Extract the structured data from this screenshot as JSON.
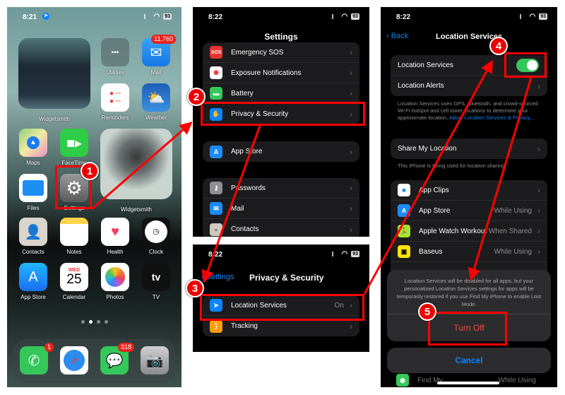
{
  "home": {
    "status": {
      "time": "8:21",
      "battery": "93"
    },
    "widgets": [
      {
        "label": "Widgetsmith"
      },
      {
        "label": "Widgetsmith"
      }
    ],
    "apps": [
      {
        "label": "Utilities"
      },
      {
        "label": "Mail",
        "badge": "11,760"
      },
      {
        "label": "Reminders"
      },
      {
        "label": "Weather"
      },
      {
        "label": "Maps"
      },
      {
        "label": "FaceTime"
      },
      {
        "label": "Files"
      },
      {
        "label": "Settings"
      },
      {
        "label": "Contacts"
      },
      {
        "label": "Notes"
      },
      {
        "label": "Health"
      },
      {
        "label": "Clock"
      },
      {
        "label": "App Store"
      },
      {
        "label": "Calendar",
        "day": "WED",
        "date": "25"
      },
      {
        "label": "Photos"
      },
      {
        "label": "TV"
      }
    ],
    "dock": [
      {
        "name": "Phone",
        "badge": "1"
      },
      {
        "name": "Safari"
      },
      {
        "name": "Messages",
        "badge": "318"
      },
      {
        "name": "Camera"
      }
    ]
  },
  "settings": {
    "status": {
      "time": "8:22",
      "battery": "93"
    },
    "title": "Settings",
    "rows": [
      {
        "label": "Emergency SOS",
        "icon": "SOS"
      },
      {
        "label": "Exposure Notifications"
      },
      {
        "label": "Battery"
      },
      {
        "label": "Privacy & Security"
      },
      {
        "label": "App Store"
      },
      {
        "label": "Passwords"
      },
      {
        "label": "Mail"
      },
      {
        "label": "Contacts"
      }
    ]
  },
  "privacy": {
    "status": {
      "time": "8:22",
      "battery": "93"
    },
    "back": "Settings",
    "title": "Privacy & Security",
    "rows": [
      {
        "label": "Location Services",
        "value": "On"
      },
      {
        "label": "Tracking"
      }
    ]
  },
  "location": {
    "status": {
      "time": "8:22",
      "battery": "93"
    },
    "back": "Back",
    "title": "Location Services",
    "toggle_label": "Location Services",
    "toggle_on": true,
    "alerts_label": "Location Alerts",
    "footnote": "Location Services uses GPS, Bluetooth, and crowd-sourced Wi-Fi hotspot and cell tower locations to determine your approximate location.",
    "footnote_link": "About Location Services & Privacy...",
    "share_label": "Share My Location",
    "share_note": "This iPhone is being used for location sharing.",
    "apps": [
      {
        "label": "App Clips",
        "value": ""
      },
      {
        "label": "App Store",
        "value": "While Using"
      },
      {
        "label": "Apple Watch Workout",
        "value": "When Shared"
      },
      {
        "label": "Baseus",
        "value": "While Using"
      },
      {
        "label": "Find My",
        "value": "While Using"
      }
    ],
    "alert": {
      "message": "Location Services will be disabled for all apps, but your personalized Location Services settings for apps will be temporarily restored if you use Find My iPhone to enable Lost Mode.",
      "turn_off": "Turn Off",
      "cancel": "Cancel"
    }
  },
  "steps": [
    "1",
    "2",
    "3",
    "4",
    "5"
  ],
  "colors": {
    "annotation": "#ff0000",
    "toggle": "#34c759",
    "link": "#0a84ff",
    "destructive": "#ff453a"
  }
}
